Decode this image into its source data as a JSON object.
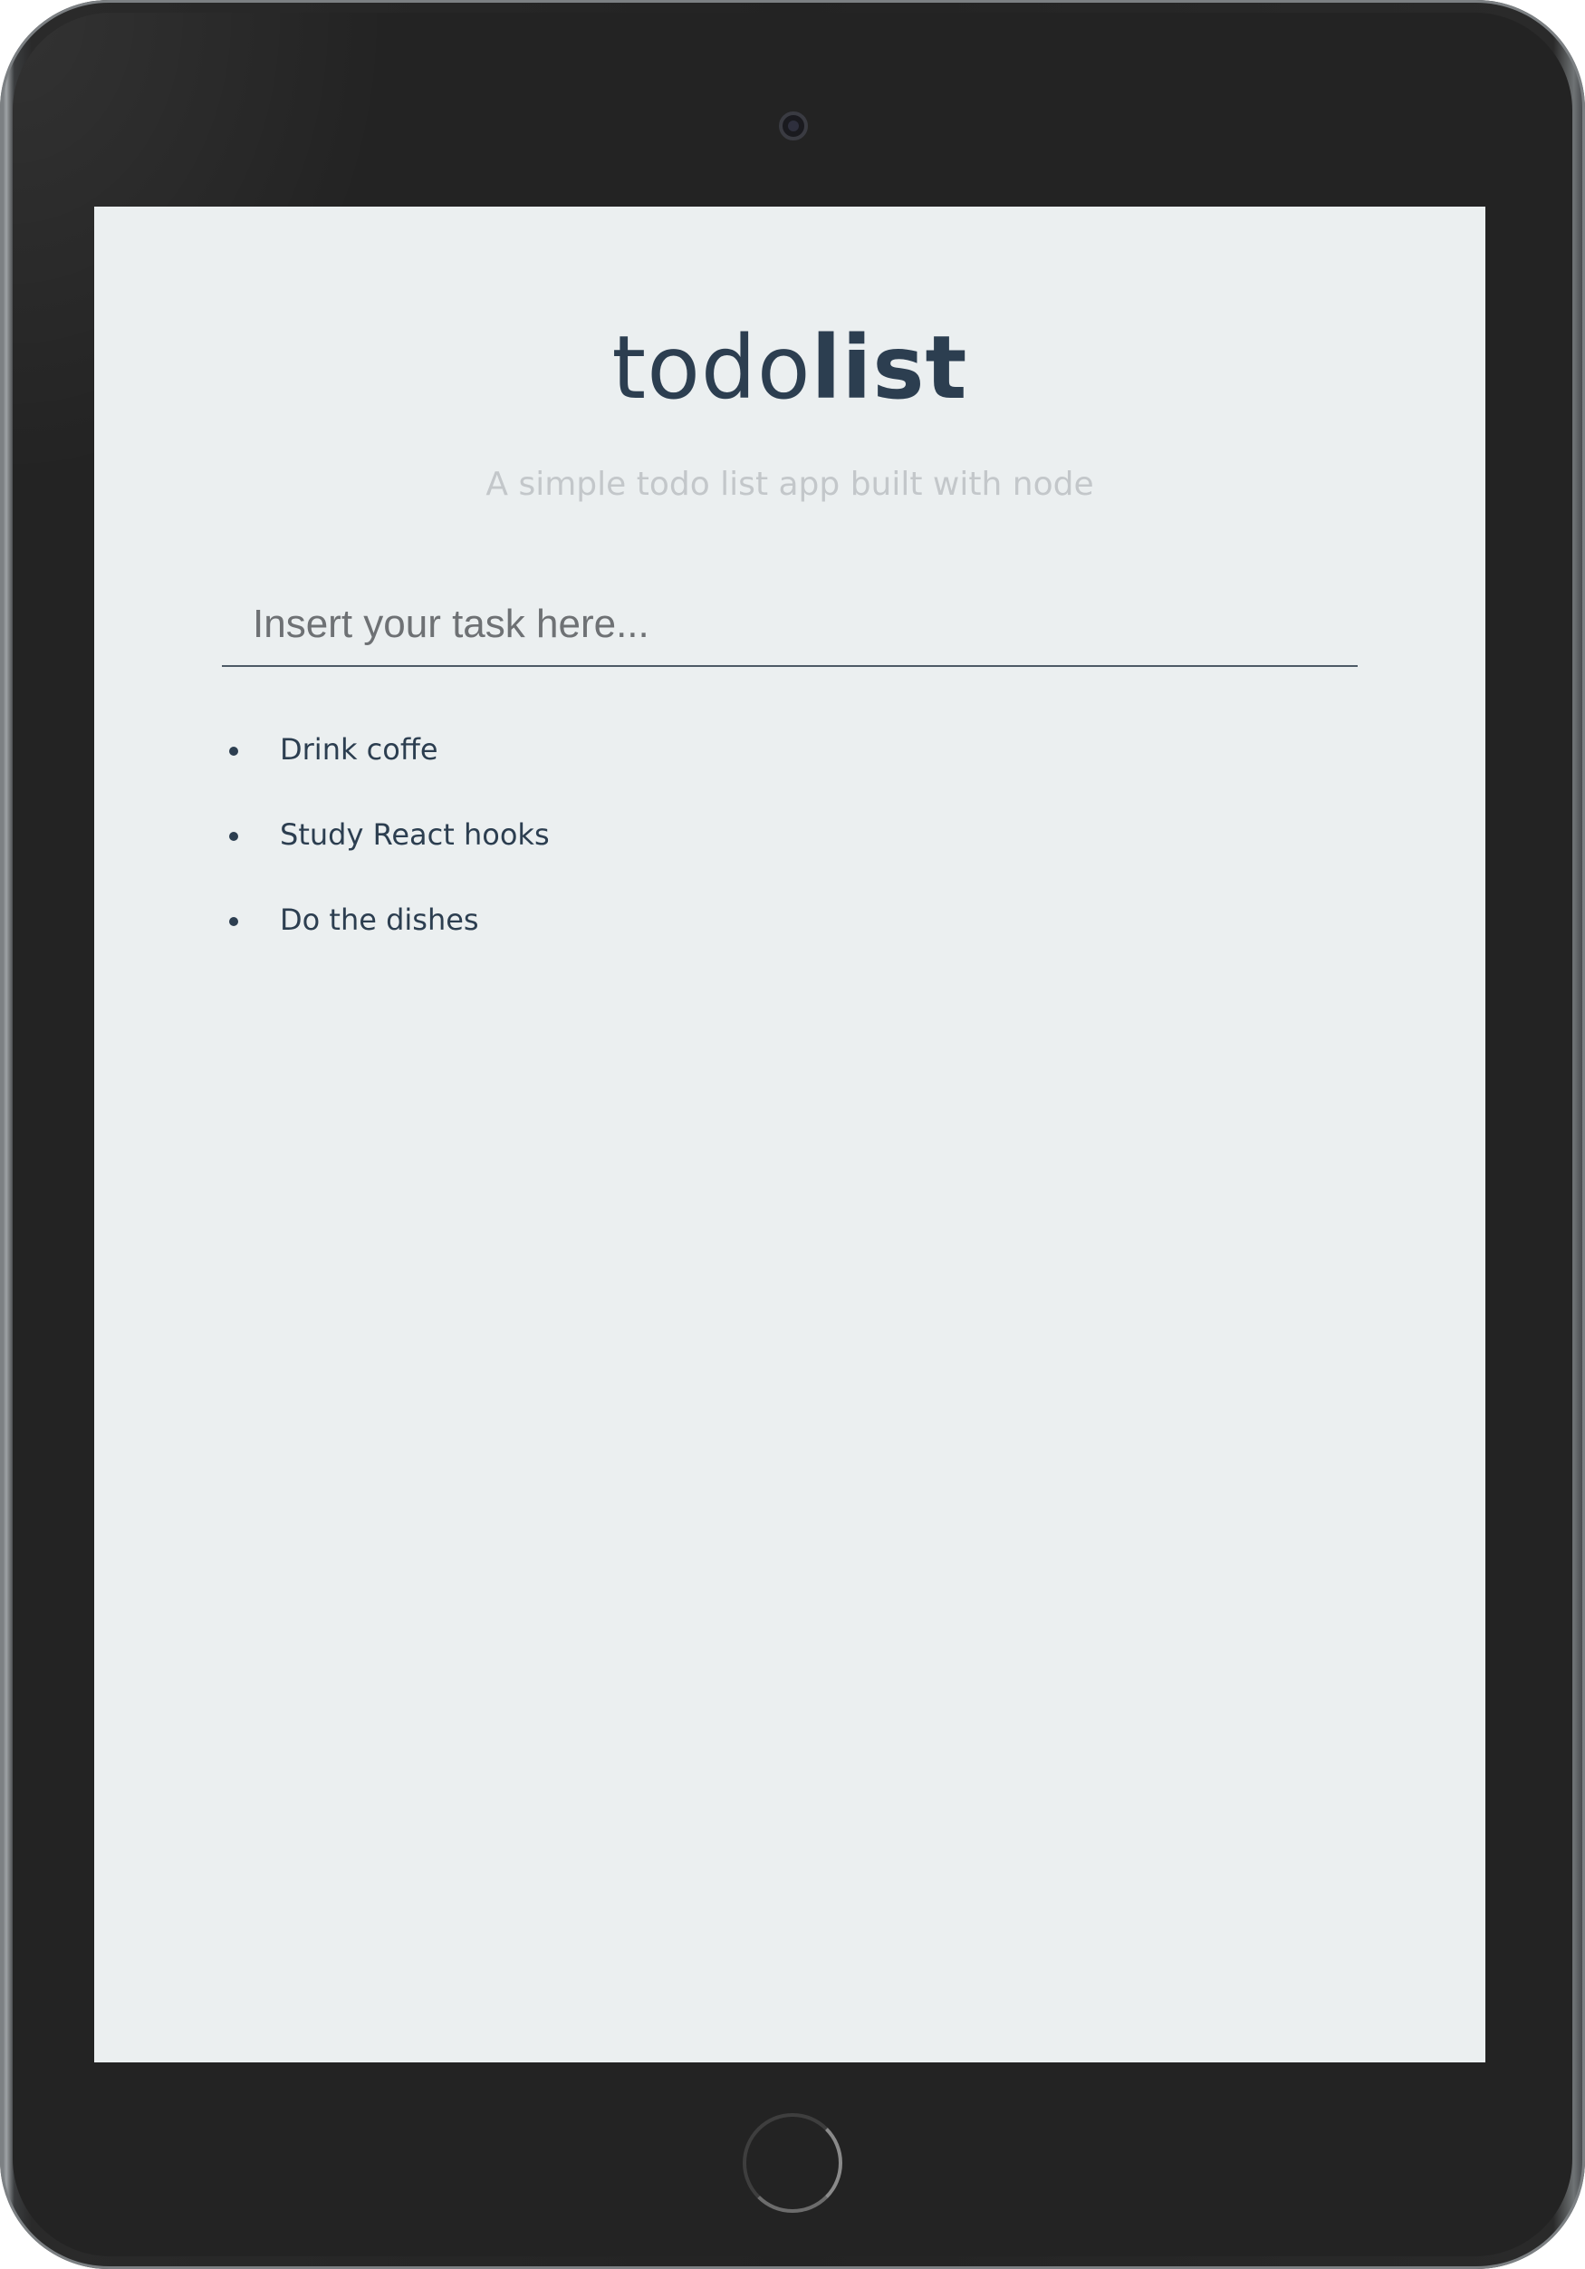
{
  "app": {
    "brand_light": "todo",
    "brand_bold": "list",
    "subtitle": "A simple todo list app built with node"
  },
  "input": {
    "placeholder": "Insert your task here...",
    "value": ""
  },
  "todos": [
    {
      "label": "Drink coffe"
    },
    {
      "label": "Study React hooks"
    },
    {
      "label": "Do the dishes"
    }
  ],
  "colors": {
    "text_primary": "#2c3e50",
    "subtitle": "#c3c7ca",
    "screen_background": "#ebeff0",
    "device_body": "#232323"
  }
}
